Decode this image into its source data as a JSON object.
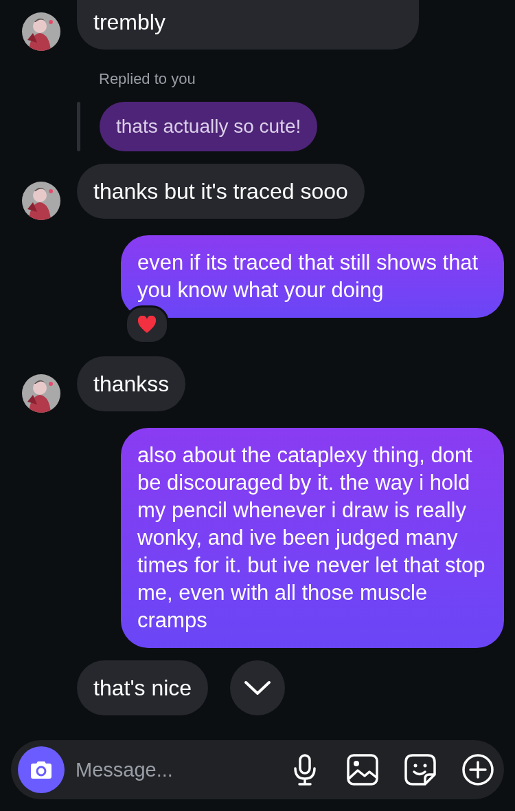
{
  "messages": [
    {
      "kind": "incoming",
      "text": "trembly",
      "avatar": true,
      "cut": true
    },
    {
      "kind": "reply",
      "label": "Replied to you",
      "quote": "thats actually so cute!"
    },
    {
      "kind": "incoming",
      "text": "thanks but it's traced sooo",
      "avatar": true,
      "cut": false
    },
    {
      "kind": "outgoing",
      "text": "even if its traced that still shows that you know what your doing",
      "reacted": true
    },
    {
      "kind": "incoming",
      "text": "thankss",
      "avatar": true,
      "cut": false
    },
    {
      "kind": "outgoing",
      "text": "also about the cataplexy thing, dont be discouraged by it. the way i hold my pencil whenever i draw is really wonky, and ive been judged many times for it. but ive never let that stop me, even with all those muscle cramps",
      "reacted": false
    },
    {
      "kind": "incoming",
      "text": "that's nice",
      "avatar": false,
      "cut": false
    }
  ],
  "composer": {
    "placeholder": "Message..."
  }
}
